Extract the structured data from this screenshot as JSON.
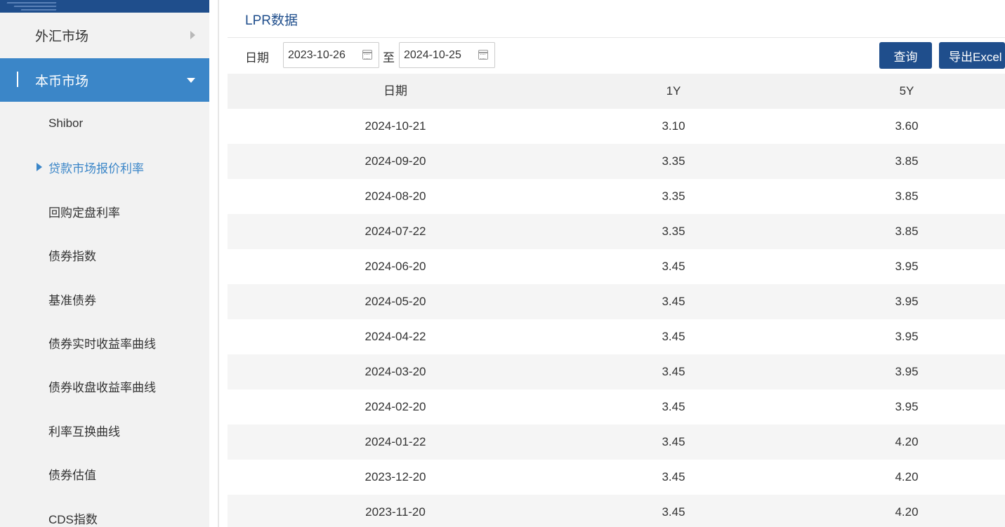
{
  "sidebar": {
    "forex_label": "外汇市场",
    "local_label": "本币市场",
    "items": [
      {
        "label": "Shibor"
      },
      {
        "label": "贷款市场报价利率"
      },
      {
        "label": "回购定盘利率"
      },
      {
        "label": "债券指数"
      },
      {
        "label": "基准债券"
      },
      {
        "label": "债券实时收益率曲线"
      },
      {
        "label": "债券收盘收益率曲线"
      },
      {
        "label": "利率互换曲线"
      },
      {
        "label": "债券估值"
      },
      {
        "label": "CDS指数"
      }
    ]
  },
  "main": {
    "title": "LPR数据",
    "filters": {
      "date_label": "日期",
      "start_date": "2023-10-26",
      "to_label": "至",
      "end_date": "2024-10-25",
      "query_button": "查询",
      "export_button": "导出Excel"
    },
    "table": {
      "columns": [
        "日期",
        "1Y",
        "5Y"
      ],
      "rows": [
        {
          "date": "2024-10-21",
          "y1": "3.10",
          "y5": "3.60"
        },
        {
          "date": "2024-09-20",
          "y1": "3.35",
          "y5": "3.85"
        },
        {
          "date": "2024-08-20",
          "y1": "3.35",
          "y5": "3.85"
        },
        {
          "date": "2024-07-22",
          "y1": "3.35",
          "y5": "3.85"
        },
        {
          "date": "2024-06-20",
          "y1": "3.45",
          "y5": "3.95"
        },
        {
          "date": "2024-05-20",
          "y1": "3.45",
          "y5": "3.95"
        },
        {
          "date": "2024-04-22",
          "y1": "3.45",
          "y5": "3.95"
        },
        {
          "date": "2024-03-20",
          "y1": "3.45",
          "y5": "3.95"
        },
        {
          "date": "2024-02-20",
          "y1": "3.45",
          "y5": "3.95"
        },
        {
          "date": "2024-01-22",
          "y1": "3.45",
          "y5": "4.20"
        },
        {
          "date": "2023-12-20",
          "y1": "3.45",
          "y5": "4.20"
        },
        {
          "date": "2023-11-20",
          "y1": "3.45",
          "y5": "4.20"
        }
      ]
    }
  },
  "colors": {
    "brand_blue": "#1f4e8c",
    "active_blue": "#3b86c8",
    "sidebar_bg": "#f2f2f2"
  }
}
